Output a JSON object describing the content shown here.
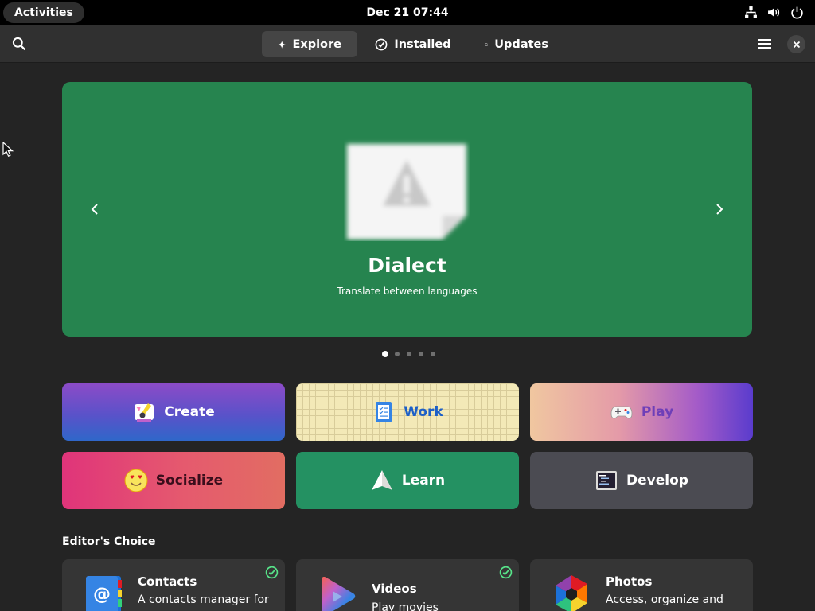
{
  "topbar": {
    "activities_label": "Activities",
    "clock": "Dec 21  07:44",
    "tray_icons": [
      "network-icon",
      "volume-icon",
      "power-icon"
    ]
  },
  "header": {
    "tabs": [
      {
        "label": "Explore",
        "icon": "sparkle-icon",
        "active": true
      },
      {
        "label": "Installed",
        "icon": "check-circle-icon",
        "active": false
      },
      {
        "label": "Updates",
        "icon": "refresh-icon",
        "active": false
      }
    ]
  },
  "featured": {
    "name": "Dialect",
    "description": "Translate between languages",
    "background_color": "#26844f",
    "page_count": 5,
    "active_page": 1
  },
  "categories": [
    {
      "label": "Create",
      "icon": "create-icon"
    },
    {
      "label": "Work",
      "icon": "checklist-icon"
    },
    {
      "label": "Play",
      "icon": "gamepad-icon"
    },
    {
      "label": "Socialize",
      "icon": "heart-eyes-emoji-icon"
    },
    {
      "label": "Learn",
      "icon": "paper-plane-icon"
    },
    {
      "label": "Develop",
      "icon": "code-editor-icon"
    }
  ],
  "editors_choice": {
    "title": "Editor's Choice",
    "apps": [
      {
        "name": "Contacts",
        "description": "A contacts manager for",
        "installed": true,
        "icon": "contacts-icon"
      },
      {
        "name": "Videos",
        "description": "Play movies",
        "installed": true,
        "icon": "videos-icon"
      },
      {
        "name": "Photos",
        "description": "Access, organize and",
        "installed": false,
        "icon": "photos-icon"
      }
    ]
  },
  "colors": {
    "window_bg": "#242424",
    "headerbar_bg": "#303030",
    "active_tab": "#454545",
    "card_bg": "#353535",
    "installed_check": "#57e389"
  }
}
